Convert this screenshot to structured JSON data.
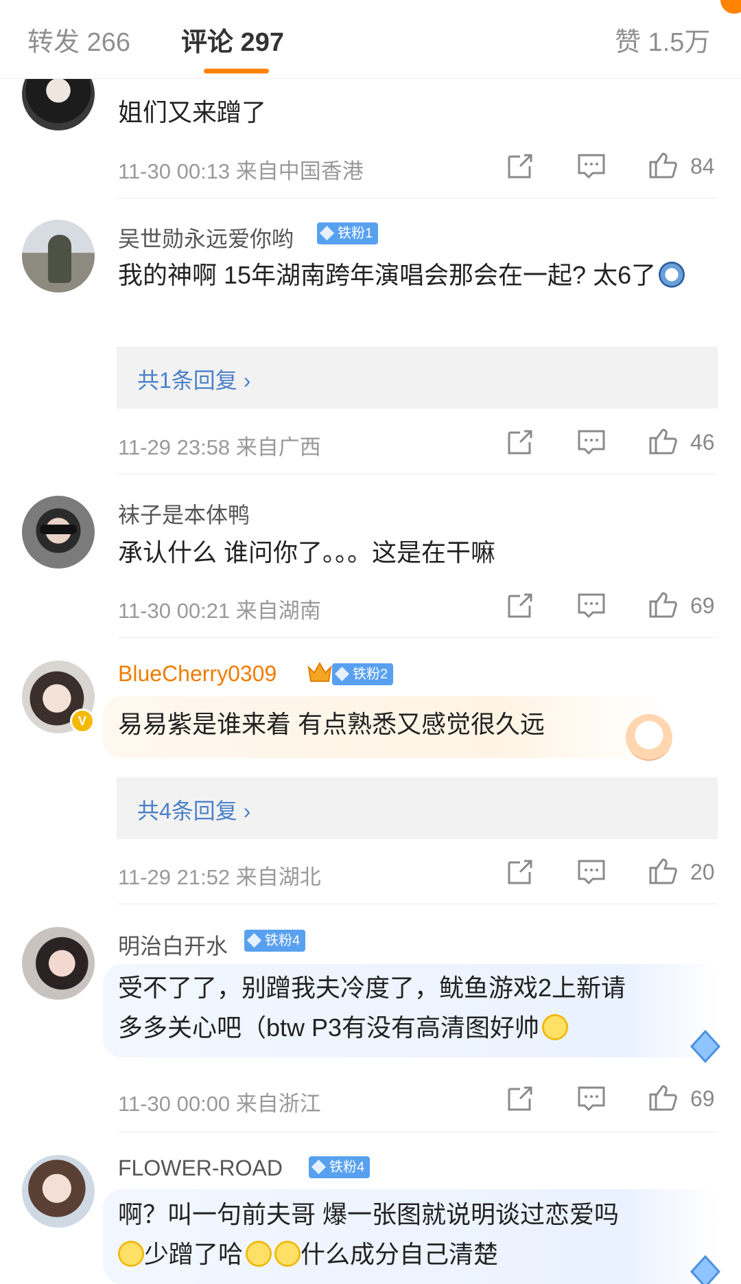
{
  "tabs": {
    "repost": "转发 266",
    "comments": "评论 297",
    "likes": "赞 1.5万"
  },
  "comments": [
    {
      "username": "",
      "text": "姐们又来蹭了",
      "time_location": "11-30 00:13  来自中国香港",
      "likes": "84"
    },
    {
      "username": "吴世勋永远爱你哟",
      "badge": "铁粉1",
      "text": "我的神啊 15年湖南跨年演唱会那会在一起? 太6了",
      "reply_link": "共1条回复",
      "time_location": "11-29 23:58  来自广西",
      "likes": "46"
    },
    {
      "username": "袜子是本体鸭",
      "text": "承认什么 谁问你了。。。这是在干嘛",
      "time_location": "11-30 00:21  来自湖南",
      "likes": "69"
    },
    {
      "username": "BlueCherry0309",
      "badge": "铁粉2",
      "text": "易易紫是谁来着 有点熟悉又感觉很久远",
      "reply_link": "共4条回复",
      "time_location": "11-29 21:52  来自湖北",
      "likes": "20"
    },
    {
      "username": "明治白开水",
      "badge": "铁粉4",
      "text_line1": "受不了了，别蹭我夫冷度了，鱿鱼游戏2上新请",
      "text_line2": "多多关心吧（btw P3有没有高清图好帅",
      "time_location": "11-30 00:00  来自浙江",
      "likes": "69"
    },
    {
      "username": "FLOWER-ROAD",
      "badge": "铁粉4",
      "text_line1": "啊？叫一句前夫哥 爆一张图就说明谈过恋爱吗",
      "text_line2": "少蹭了哈",
      "text_line2b": "什么成分自己清楚"
    }
  ],
  "icons": {
    "share": "share-icon",
    "comment": "comment-icon",
    "like": "thumbs-up-icon",
    "fan_badge": "diamond-icon"
  },
  "colors": {
    "accent": "#ff8200",
    "link": "#4a80c8",
    "badge": "#58a0f0",
    "vip_name": "#f07c00"
  }
}
